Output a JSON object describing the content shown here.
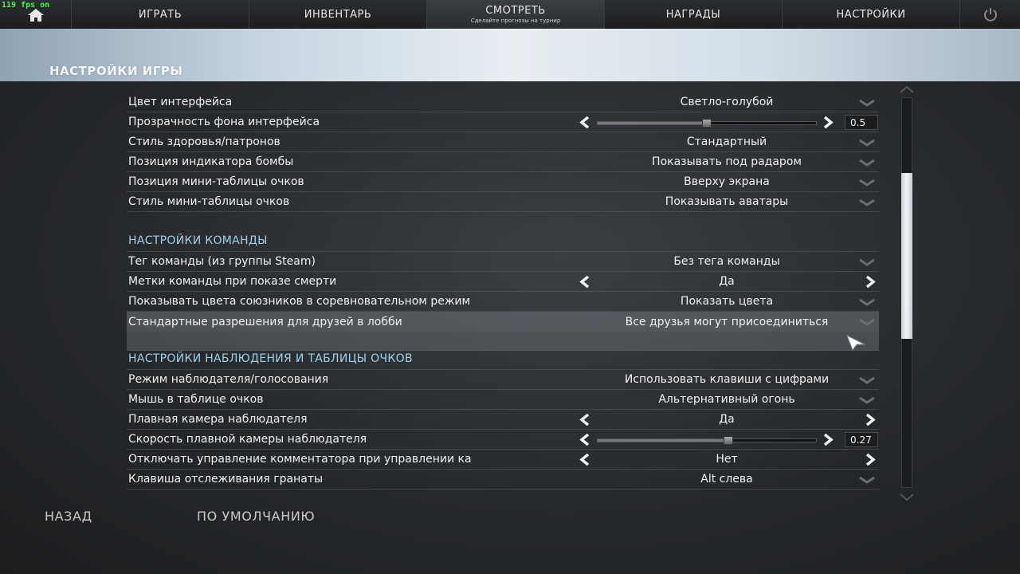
{
  "fps": "119 fps on",
  "nav": {
    "tabs": [
      {
        "label": "ИГРАТЬ",
        "sub": ""
      },
      {
        "label": "ИНВЕНТАРЬ",
        "sub": ""
      },
      {
        "label": "СМОТРЕТЬ",
        "sub": "Сделайте прогнозы на турнир"
      },
      {
        "label": "НАГРАДЫ",
        "sub": ""
      },
      {
        "label": "НАСТРОЙКИ",
        "sub": ""
      }
    ],
    "home_icon": "home-icon",
    "power_icon": "power-icon"
  },
  "banner": {
    "title": "НАСТРОЙКИ ИГРЫ"
  },
  "rows_a": [
    {
      "label": "Цвет интерфейса",
      "value": "Светло-голубой",
      "type": "dropdown"
    },
    {
      "label": "Прозрачность фона интерфейса",
      "value": "0.5",
      "type": "slider",
      "level": 0.5
    },
    {
      "label": "Стиль здоровья/патронов",
      "value": "Стандартный",
      "type": "dropdown"
    },
    {
      "label": "Позиция индикатора бомбы",
      "value": "Показывать под радаром",
      "type": "dropdown"
    },
    {
      "label": "Позиция мини-таблицы очков",
      "value": "Вверху экрана",
      "type": "dropdown"
    },
    {
      "label": "Стиль мини-таблицы очков",
      "value": "Показывать аватары",
      "type": "dropdown"
    }
  ],
  "section_team": "НАСТРОЙКИ КОМАНДЫ",
  "rows_b": [
    {
      "label": "Тег команды (из группы Steam)",
      "value": "Без тега команды",
      "type": "dropdown"
    },
    {
      "label": "Метки команды при показе смерти",
      "value": "Да",
      "type": "toggle"
    },
    {
      "label": "Показывать цвета союзников в соревновательном режим",
      "value": "Показать цвета",
      "type": "dropdown"
    },
    {
      "label": "Стандартные разрешения для друзей в лобби",
      "value": "Все друзья могут присоединиться",
      "type": "dropdown"
    }
  ],
  "section_spectator": "НАСТРОЙКИ НАБЛЮДЕНИЯ И ТАБЛИЦЫ ОЧКОВ",
  "rows_c": [
    {
      "label": "Режим наблюдателя/голосования",
      "value": "Использовать клавиши с цифрами",
      "type": "dropdown"
    },
    {
      "label": "Мышь в таблице очков",
      "value": "Альтернативный огонь",
      "type": "dropdown"
    },
    {
      "label": "Плавная камера наблюдателя",
      "value": "Да",
      "type": "toggle"
    },
    {
      "label": "Скорость плавной камеры наблюдателя",
      "value": "0.27",
      "type": "slider",
      "level": 0.6
    },
    {
      "label": "Отключать управление комментатора при управлении ка",
      "value": "Нет",
      "type": "toggle"
    },
    {
      "label": "Клавиша отслеживания гранаты",
      "value": "Alt слева",
      "type": "dropdown"
    }
  ],
  "footer": {
    "back": "НАЗАД",
    "defaults": "ПО УМОЛЧАНИЮ"
  },
  "colors": {
    "section_title": "#9fd0ea",
    "fps": "#37ff37"
  }
}
